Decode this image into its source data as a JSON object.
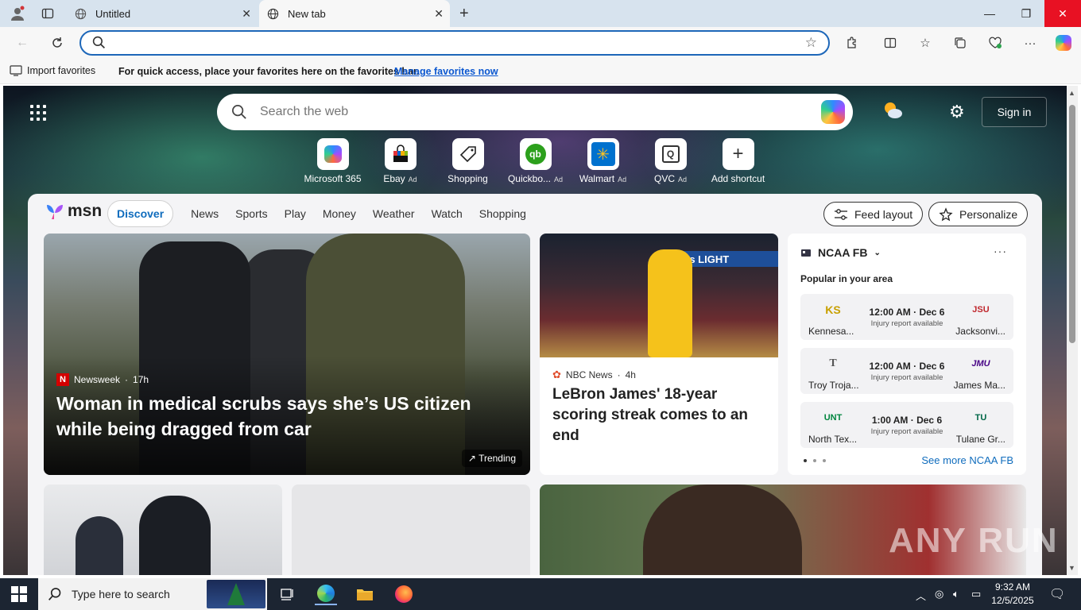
{
  "tabs": [
    {
      "title": "Untitled"
    },
    {
      "title": "New tab"
    }
  ],
  "address_bar": {
    "value": "",
    "placeholder": ""
  },
  "favorites_bar": {
    "import_label": "Import favorites",
    "message": "For quick access, place your favorites here on the favorites bar.",
    "link": "Manage favorites now"
  },
  "newtab": {
    "search_placeholder": "Search the web",
    "sign_in": "Sign in",
    "shortcuts": [
      {
        "label": "Microsoft 365",
        "ad": ""
      },
      {
        "label": "Ebay",
        "ad": "Ad"
      },
      {
        "label": "Shopping",
        "ad": ""
      },
      {
        "label": "Quickbo...",
        "ad": "Ad"
      },
      {
        "label": "Walmart",
        "ad": "Ad"
      },
      {
        "label": "QVC",
        "ad": "Ad"
      },
      {
        "label": "Add shortcut",
        "ad": ""
      }
    ]
  },
  "msn": {
    "logo": "msn",
    "nav": [
      "Discover",
      "News",
      "Sports",
      "Play",
      "Money",
      "Weather",
      "Watch",
      "Shopping"
    ],
    "feed_layout": "Feed layout",
    "personalize": "Personalize",
    "hero": {
      "source": "Newsweek",
      "age": "17h",
      "title": "Woman in medical scrubs says she’s US citizen while being dragged from car",
      "badge": "Trending"
    },
    "card2": {
      "source": "NBC News",
      "age": "4h",
      "title": "LeBron James' 18-year scoring streak comes to an end",
      "sign_text": "Coors LIGHT"
    },
    "ncaa": {
      "title": "NCAA FB",
      "subtitle": "Popular in your area",
      "games": [
        {
          "team1": "Kennesa...",
          "team2": "Jacksonvi...",
          "time": "12:00 AM · Dec 6",
          "note": "Injury report available",
          "logo1": "KS",
          "logo2": "JSU"
        },
        {
          "team1": "Troy Troja...",
          "team2": "James Ma...",
          "time": "12:00 AM · Dec 6",
          "note": "Injury report available",
          "logo1": "T",
          "logo2": "JMU"
        },
        {
          "team1": "North Tex...",
          "team2": "Tulane Gr...",
          "time": "1:00 AM · Dec 6",
          "note": "Injury report available",
          "logo1": "UNT",
          "logo2": "TU"
        }
      ],
      "see_more": "See more NCAA FB"
    }
  },
  "watermark": "ANY RUN",
  "taskbar": {
    "search_placeholder": "Type here to search",
    "time": "9:32 AM",
    "date": "12/5/2025"
  },
  "colors": {
    "accent": "#0f6cbd",
    "address_border": "#1d67b9",
    "close_red": "#e81123",
    "taskbar": "#1c2532"
  }
}
